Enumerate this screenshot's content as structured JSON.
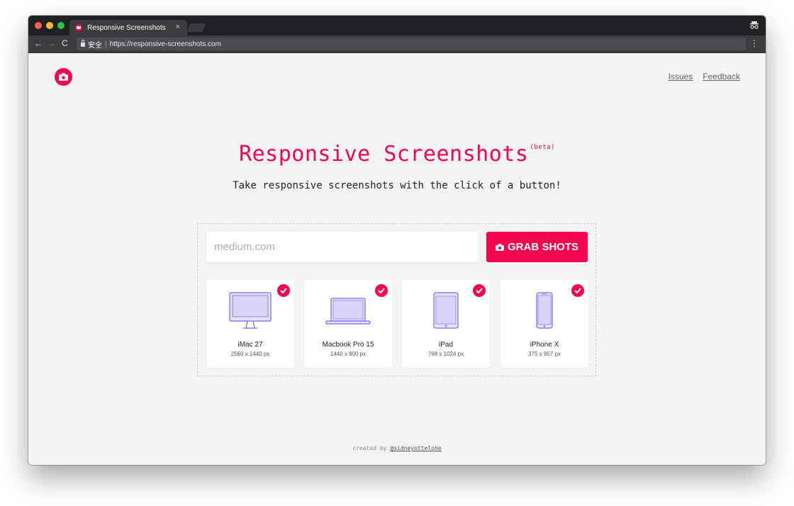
{
  "browser": {
    "tab_title": "Responsive Screenshots",
    "tab_close": "×",
    "secure_label": "安全",
    "url": "https://responsive-screenshots.com",
    "favicon_color": "#f5054f"
  },
  "header": {
    "links": [
      "Issues",
      "Feedback"
    ]
  },
  "hero": {
    "title": "Responsive Screenshots",
    "badge": "(beta)",
    "subtitle": "Take responsive screenshots with the click of a button!"
  },
  "form": {
    "placeholder": "medium.com",
    "value": "",
    "button_label": "GRAB SHOTS"
  },
  "devices": [
    {
      "name": "iMac 27",
      "resolution": "2560 x 1440 px",
      "icon": "imac-icon",
      "checked": true
    },
    {
      "name": "Macbook Pro 15",
      "resolution": "1440 x 900 px",
      "icon": "macbook-icon",
      "checked": true
    },
    {
      "name": "iPad",
      "resolution": "768 x 1024 px",
      "icon": "ipad-icon",
      "checked": true
    },
    {
      "name": "iPhone X",
      "resolution": "375 x 957 px",
      "icon": "iphone-icon",
      "checked": true
    }
  ],
  "footer": {
    "prefix": "created by",
    "author": "@sidneyottelohe"
  },
  "colors": {
    "accent": "#f5054f",
    "device_outline": "#7d63ee",
    "device_fill": "#e6e3fb",
    "background": "#f4f4f4"
  }
}
